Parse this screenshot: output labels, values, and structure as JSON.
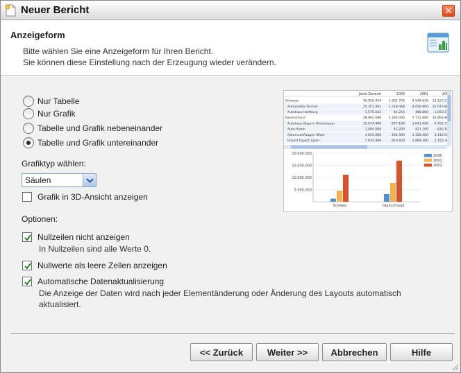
{
  "window": {
    "title": "Neuer Bericht"
  },
  "header": {
    "title": "Anzeigeform",
    "line1": "Bitte wählen Sie eine Anzeigeform für Ihren Bericht.",
    "line2": "Sie können diese Einstellung nach der Erzeugung wieder verändern."
  },
  "display_mode": {
    "options": [
      "Nur Tabelle",
      "Nur Grafik",
      "Tabelle und Grafik nebeneinander",
      "Tabelle und Grafik untereinander"
    ],
    "selected": "Tabelle und Grafik untereinander"
  },
  "chart_type": {
    "label": "Grafiktyp wählen:",
    "value": "Säulen",
    "view3d_label": "Grafik in 3D-Ansicht anzeigen",
    "view3d_checked": false
  },
  "options": {
    "label": "Optionen:",
    "null_rows_label": "Nullzeilen nicht anzeigen",
    "null_rows_sub": "In Nullzeilen sind alle Werte 0.",
    "null_rows_checked": true,
    "null_values_label": "Nullwerte als leere Zellen anzeigen",
    "null_values_checked": true,
    "auto_update_label": "Automatische Datenaktualisierung",
    "auto_update_sub1": "Die Anzeige der Daten wird nach jeder Elementänderung oder Änderung des Layouts automatisch",
    "auto_update_sub2": "aktualisiert.",
    "auto_update_checked": true
  },
  "preview": {
    "table_headers": [
      "Jahre Gesamt",
      "2000",
      "2001",
      "2002"
    ],
    "table_rows": [
      [
        "Schweiz",
        "16.926.444",
        "1.282.705",
        "4.548.626",
        "11.123.210"
      ],
      [
        "Automobile Fischer",
        "15.351.481",
        "1.218.468",
        "4.058.860",
        "10.073.881"
      ],
      [
        "Autohaus Hartberg",
        "1.575.042",
        "44.215",
        "488.860",
        "1.050.159"
      ],
      [
        "Deutschland",
        "28.962.688",
        "3.185.000",
        "7.713.800",
        "16.963.888"
      ],
      [
        "Autohaus Bayern Hinterbauer",
        "13.574.489",
        "877.100",
        "3.641.600",
        "9.755.789"
      ],
      [
        "Auto Huber",
        "1.094.088",
        "42.200",
        "421.700",
        "630.188"
      ],
      [
        "Ostersachfwagen Maier",
        "4.935.088",
        "184.900",
        "1.328.400",
        "3.412.688"
      ],
      [
        "Import Export Zylan",
        "7.934.489",
        "910.600",
        "1.868.300",
        "5.155.389"
      ]
    ],
    "legend": [
      "2000",
      "2001",
      "2002"
    ],
    "colors": [
      "#4f8fd8",
      "#f4b24a",
      "#d9522b"
    ],
    "y_ticks": [
      "20.000.000",
      "15.000.000",
      "10.000.000",
      "5.000.000"
    ],
    "categories": [
      "Schweiz",
      "Deutschland"
    ]
  },
  "chart_data": {
    "type": "bar",
    "categories": [
      "Schweiz",
      "Deutschland"
    ],
    "series": [
      {
        "name": "2000",
        "values": [
          1282705,
          3185000
        ]
      },
      {
        "name": "2001",
        "values": [
          4548626,
          7713800
        ]
      },
      {
        "name": "2002",
        "values": [
          11123210,
          16963888
        ]
      }
    ],
    "ylim": [
      0,
      20000000
    ]
  },
  "buttons": {
    "back": "<< Zurück",
    "next": "Weiter >>",
    "cancel": "Abbrechen",
    "help": "Hilfe"
  }
}
